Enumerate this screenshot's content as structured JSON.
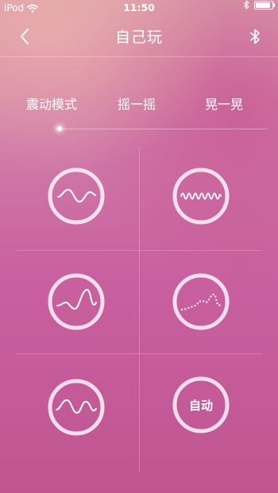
{
  "status_bar": {
    "carrier": "iPod",
    "time": "11:50",
    "battery_level": 0.9,
    "icons": [
      "wifi-icon",
      "bluetooth-icon",
      "battery-icon"
    ]
  },
  "nav": {
    "title": "自己玩",
    "back_icon": "chevron-left-icon",
    "bluetooth_icon": "bluetooth-icon"
  },
  "tabs": [
    {
      "label": "震动模式",
      "selected": true
    },
    {
      "label": "摇一摇",
      "selected": false
    },
    {
      "label": "晃一晃",
      "selected": false
    }
  ],
  "modes": [
    {
      "icon": "wave-slow-icon"
    },
    {
      "icon": "wave-fast-icon"
    },
    {
      "icon": "wave-rising-icon"
    },
    {
      "icon": "wave-dotted-icon"
    },
    {
      "icon": "wave-gentle-icon"
    },
    {
      "icon": "auto-icon",
      "label": "自动"
    }
  ],
  "colors": {
    "background_top": "#d99aa8",
    "background_bottom": "#bf5690",
    "foreground": "#ffffff"
  }
}
